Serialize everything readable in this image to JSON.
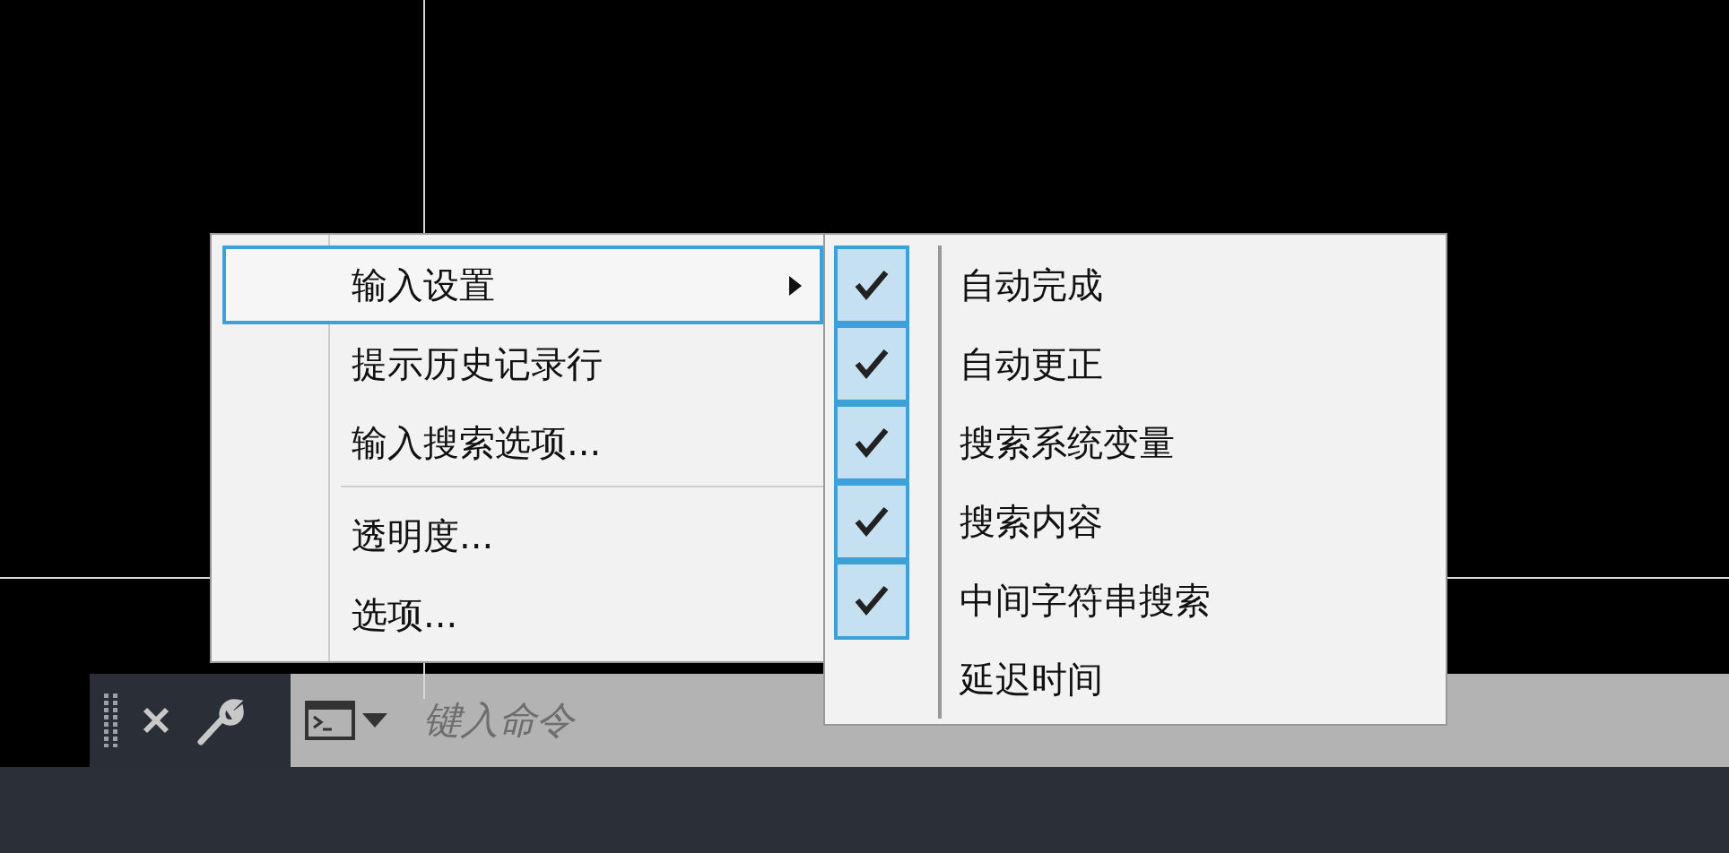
{
  "context_menu": {
    "items": [
      {
        "kind": "submenu",
        "label": "输入设置",
        "selected": true
      },
      {
        "kind": "item",
        "label": "提示历史记录行",
        "selected": false
      },
      {
        "kind": "item",
        "label": "输入搜索选项...",
        "selected": false
      },
      {
        "kind": "separator"
      },
      {
        "kind": "item",
        "label": "透明度...",
        "selected": false
      },
      {
        "kind": "item",
        "label": "选项...",
        "selected": false
      }
    ]
  },
  "submenu": {
    "items": [
      {
        "label": "自动完成",
        "checked": true
      },
      {
        "label": "自动更正",
        "checked": true
      },
      {
        "label": "搜索系统变量",
        "checked": true
      },
      {
        "label": "搜索内容",
        "checked": true
      },
      {
        "label": "中间字符串搜索",
        "checked": true
      },
      {
        "label": "延迟时间",
        "checked": false
      }
    ]
  },
  "command_line": {
    "placeholder": "键入命令"
  }
}
